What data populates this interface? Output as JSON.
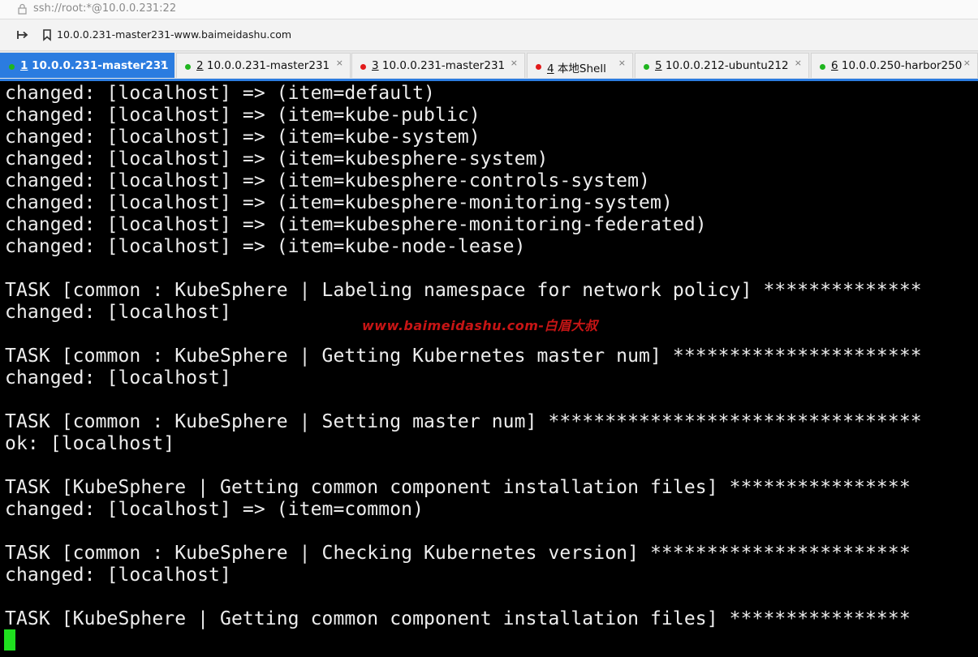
{
  "address_bar": {
    "text": "ssh://root:*@10.0.0.231:22"
  },
  "toolbar": {
    "bookmark_text": "10.0.0.231-master231-www.baimeidashu.com"
  },
  "tabs": [
    {
      "num": "1",
      "label": " 10.0.0.231-master231",
      "status": "green",
      "active": true
    },
    {
      "num": "2",
      "label": " 10.0.0.231-master231",
      "status": "green",
      "active": false
    },
    {
      "num": "3",
      "label": " 10.0.0.231-master231",
      "status": "red",
      "active": false
    },
    {
      "num": "4",
      "label": " 本地Shell",
      "status": "red",
      "active": false
    },
    {
      "num": "5",
      "label": " 10.0.0.212-ubuntu212",
      "status": "green",
      "active": false
    },
    {
      "num": "6",
      "label": " 10.0.0.250-harbor250",
      "status": "green",
      "active": false
    }
  ],
  "tab_close_glyph": "×",
  "status_colors": {
    "green": "#1fb51f",
    "red": "#e21b1b",
    "accent": "#2b7ce0",
    "cursor": "#1fe01f"
  },
  "terminal": {
    "lines": [
      "changed: [localhost] => (item=default)",
      "changed: [localhost] => (item=kube-public)",
      "changed: [localhost] => (item=kube-system)",
      "changed: [localhost] => (item=kubesphere-system)",
      "changed: [localhost] => (item=kubesphere-controls-system)",
      "changed: [localhost] => (item=kubesphere-monitoring-system)",
      "changed: [localhost] => (item=kubesphere-monitoring-federated)",
      "changed: [localhost] => (item=kube-node-lease)",
      "",
      "TASK [common : KubeSphere | Labeling namespace for network policy] **************",
      "changed: [localhost]",
      "",
      "TASK [common : KubeSphere | Getting Kubernetes master num] **********************",
      "changed: [localhost]",
      "",
      "TASK [common : KubeSphere | Setting master num] *********************************",
      "ok: [localhost]",
      "",
      "TASK [KubeSphere | Getting common component installation files] ****************",
      "changed: [localhost] => (item=common)",
      "",
      "TASK [common : KubeSphere | Checking Kubernetes version] ***********************",
      "changed: [localhost]",
      "",
      "TASK [KubeSphere | Getting common component installation files] ****************"
    ],
    "watermark": "www.baimeidashu.com-白眉大叔"
  }
}
